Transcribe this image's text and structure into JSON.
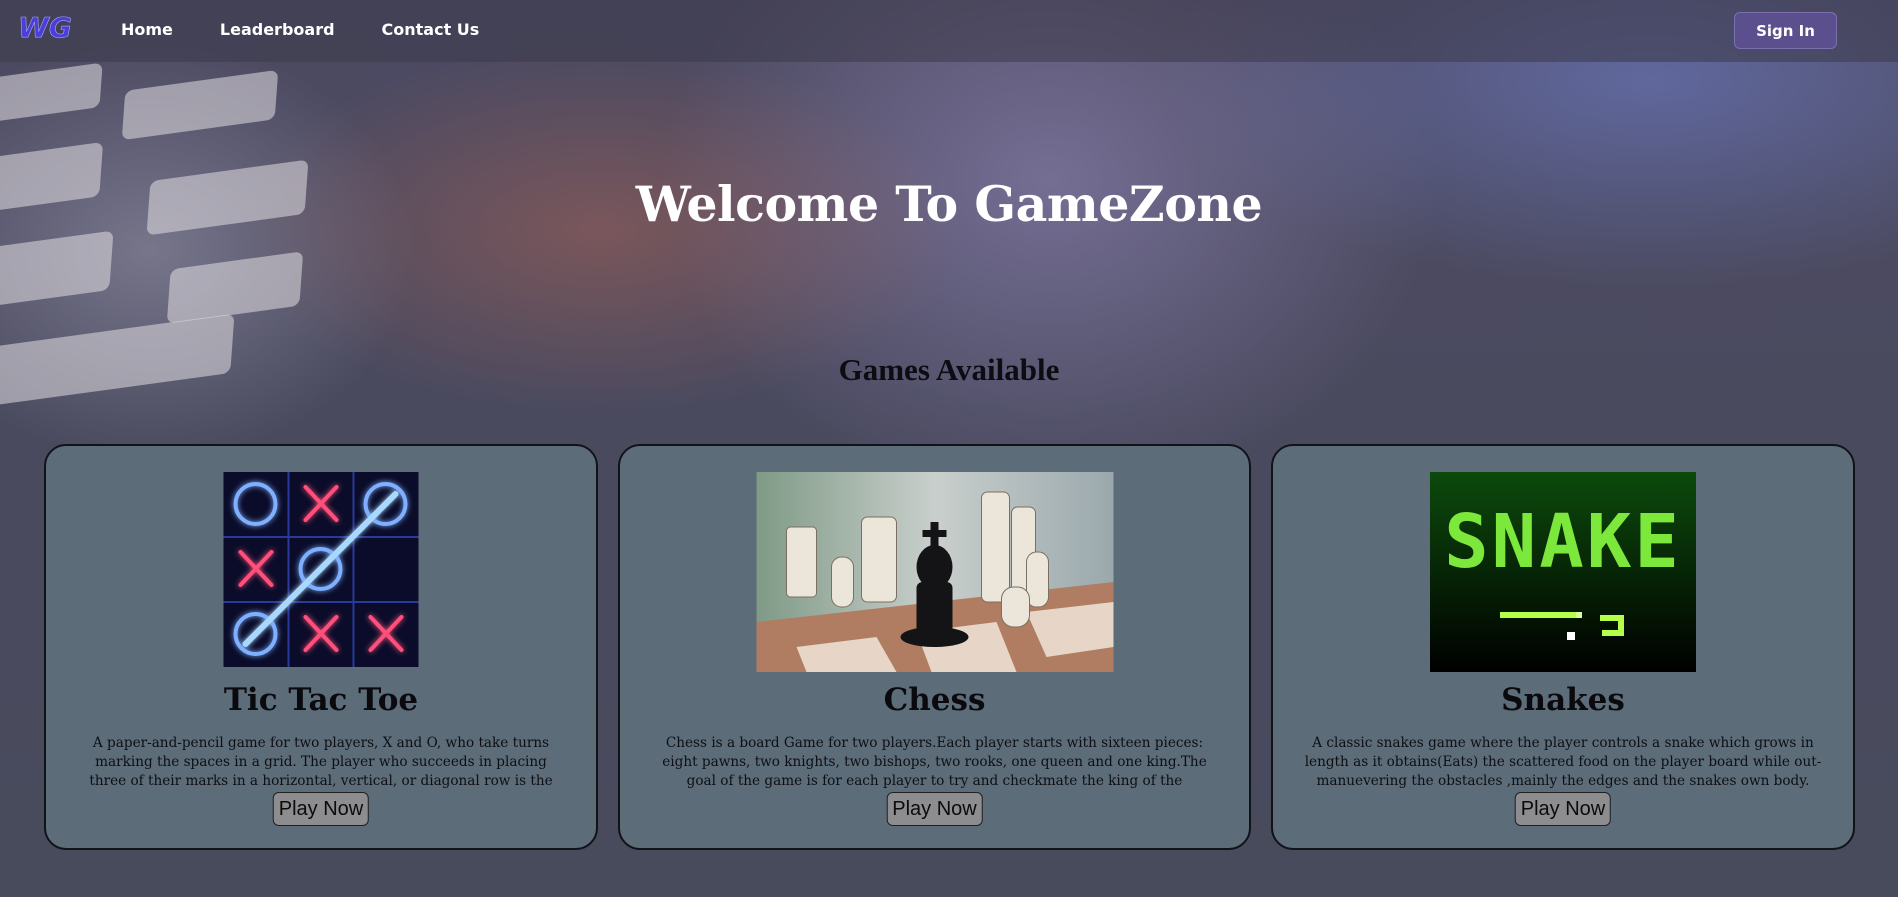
{
  "header": {
    "logo_text": "WG",
    "nav": [
      {
        "label": "Home"
      },
      {
        "label": "Leaderboard"
      },
      {
        "label": "Contact Us"
      }
    ],
    "signin_label": "Sign In"
  },
  "hero": {
    "title": "Welcome To GameZone"
  },
  "games_section": {
    "title": "Games Available",
    "games": [
      {
        "name": "Tic Tac Toe",
        "description": "A paper-and-pencil game for two players, X and O, who take turns marking the spaces in a grid. The player who succeeds in placing three of their marks in a horizontal, vertical, or diagonal row is the winner.",
        "button_label": "Play Now",
        "image": "tic-tac-toe-neon-board"
      },
      {
        "name": "Chess",
        "description": "Chess is a board Game for two players.Each player starts with sixteen pieces: eight pawns, two knights, two bishops, two rooks, one queen and one king.The goal of the game is for each player to try and checkmate the king of the opponent.",
        "button_label": "Play Now",
        "image": "chess-pieces-photo"
      },
      {
        "name": "Snakes",
        "description": "A classic snakes game where the player controls a snake which grows in length as it obtains(Eats) the scattered food on the player board while out-manuevering the obstacles ,mainly the edges and the snakes own body.",
        "button_label": "Play Now",
        "image": "snake-pixel-art",
        "image_text": "SNAKE"
      }
    ]
  },
  "colors": {
    "card_bg": "#5c6c78",
    "signin_bg": "#5c4f8d",
    "button_bg": "#8d8d8f"
  }
}
